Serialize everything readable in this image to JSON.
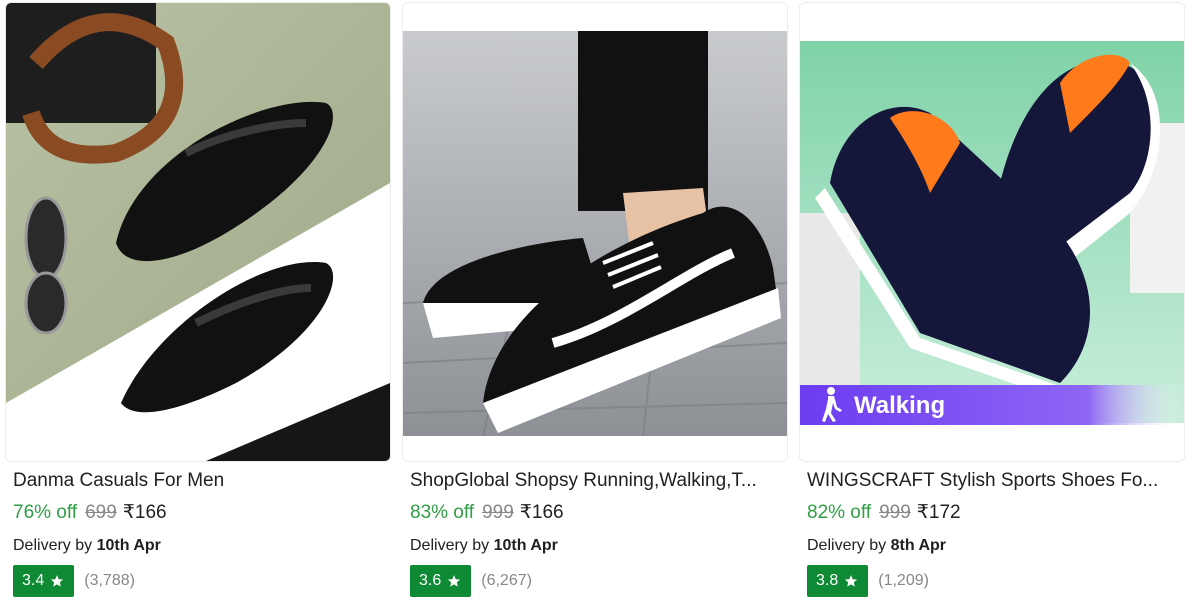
{
  "products": [
    {
      "name": "Danma Casuals For Men",
      "discount": "76% off",
      "mrp": "699",
      "price": "₹166",
      "delivery_prefix": "Delivery by",
      "delivery_date": "10th Apr",
      "rating": "3.4",
      "rating_count": "(3,788)",
      "image": "black-leather-loafers"
    },
    {
      "name": "ShopGlobal Shopsy Running,Walking,T...",
      "discount": "83% off",
      "mrp": "999",
      "price": "₹166",
      "delivery_prefix": "Delivery by",
      "delivery_date": "10th Apr",
      "rating": "3.6",
      "rating_count": "(6,267)",
      "image": "black-white-sneakers"
    },
    {
      "name": "WINGSCRAFT Stylish Sports Shoes Fo...",
      "discount": "82% off",
      "mrp": "999",
      "price": "₹172",
      "delivery_prefix": "Delivery by",
      "delivery_date": "8th Apr",
      "rating": "3.8",
      "rating_count": "(1,209)",
      "image": "navy-slip-on-shoes",
      "tag": "Walking"
    }
  ],
  "colors": {
    "discount": "#2f9e44",
    "rating_badge": "#0d8a33",
    "muted": "#878787",
    "walking_tag": "#6c3cf0"
  },
  "icons": [
    "star-icon",
    "walking-person-icon"
  ]
}
